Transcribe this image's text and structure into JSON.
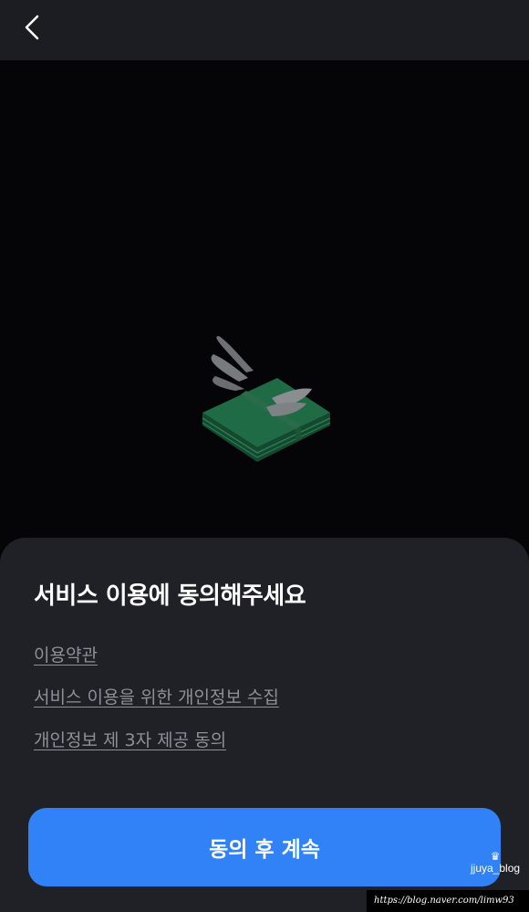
{
  "header": {
    "back_icon": "chevron-left-icon"
  },
  "hero": {
    "illustration": "winged-money-stack-icon"
  },
  "sheet": {
    "title": "서비스 이용에 동의해주세요",
    "terms": [
      {
        "label": "이용약관"
      },
      {
        "label": "서비스 이용을 위한 개인정보 수집"
      },
      {
        "label": "개인정보 제 3자 제공 동의"
      }
    ],
    "cta_label": "동의 후 계속"
  },
  "watermark": {
    "badge": "jjuya_blog",
    "url": "https://blog.naver.com/limw93"
  },
  "colors": {
    "background": "#050508",
    "header": "#1c1d22",
    "sheet": "#202127",
    "link": "#8e9098",
    "accent": "#3182f6"
  }
}
